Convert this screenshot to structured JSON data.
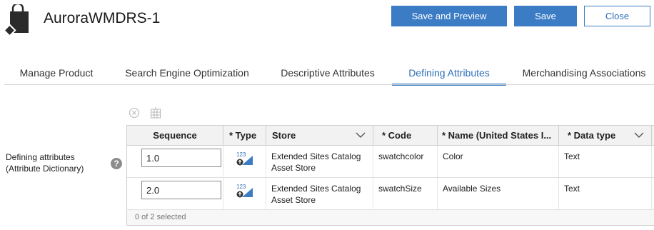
{
  "header": {
    "title": "AuroraWMDRS-1",
    "buttons": {
      "save_preview": "Save and Preview",
      "save": "Save",
      "close": "Close"
    }
  },
  "tabs": [
    {
      "label": "Manage Product",
      "active": false
    },
    {
      "label": "Search Engine Optimization",
      "active": false
    },
    {
      "label": "Descriptive Attributes",
      "active": false
    },
    {
      "label": "Defining Attributes",
      "active": true
    },
    {
      "label": "Merchandising Associations",
      "active": false
    }
  ],
  "toolbar": {
    "icons": [
      "delete-icon",
      "column-config-icon"
    ]
  },
  "field": {
    "label_line1": "Defining attributes",
    "label_line2": "(Attribute Dictionary)",
    "help": "?"
  },
  "grid": {
    "columns": [
      "Sequence",
      "* Type",
      "Store",
      "* Code",
      "* Name (United States I...",
      "* Data type"
    ],
    "rows": [
      {
        "sequence": "1.0",
        "type_icon": "numeric-type-icon",
        "store_line1": "Extended Sites Catalog",
        "store_line2": "Asset Store",
        "code": "swatchcolor",
        "name": "Color",
        "data_type": "Text"
      },
      {
        "sequence": "2.0",
        "type_icon": "numeric-type-icon",
        "store_line1": "Extended Sites Catalog",
        "store_line2": "Asset Store",
        "code": "swatchSize",
        "name": "Available Sizes",
        "data_type": "Text"
      }
    ],
    "status": "0 of 2 selected"
  },
  "colors": {
    "accent": "#3b7cc5",
    "tab_active": "#2c6fb8"
  }
}
